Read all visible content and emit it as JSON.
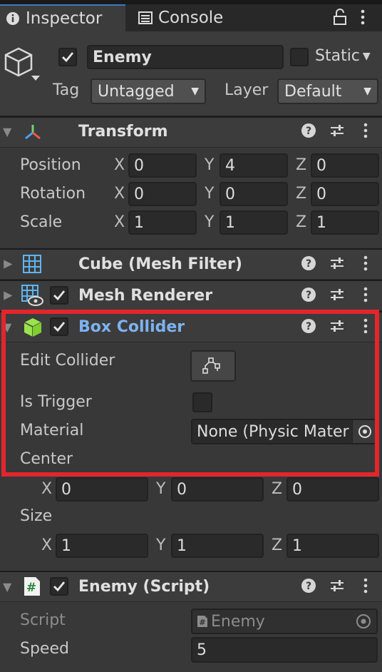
{
  "tabs": {
    "inspector": "Inspector",
    "console": "Console"
  },
  "object": {
    "name": "Enemy",
    "static_label": "Static",
    "tag_label": "Tag",
    "tag_value": "Untagged",
    "layer_label": "Layer",
    "layer_value": "Default"
  },
  "transform": {
    "title": "Transform",
    "rows": [
      {
        "label": "Position",
        "x": "0",
        "y": "4",
        "z": "0"
      },
      {
        "label": "Rotation",
        "x": "0",
        "y": "0",
        "z": "0"
      },
      {
        "label": "Scale",
        "x": "1",
        "y": "1",
        "z": "1"
      }
    ]
  },
  "axes": {
    "x": "X",
    "y": "Y",
    "z": "Z"
  },
  "mesh_filter": {
    "title": "Cube (Mesh Filter)"
  },
  "mesh_renderer": {
    "title": "Mesh Renderer"
  },
  "box_collider": {
    "title": "Box Collider",
    "edit_collider": "Edit Collider",
    "is_trigger": "Is Trigger",
    "material_label": "Material",
    "material_value": "None (Physic Mater",
    "center_label": "Center",
    "center": {
      "x": "0",
      "y": "0",
      "z": "0"
    },
    "size_label": "Size",
    "size": {
      "x": "1",
      "y": "1",
      "z": "1"
    }
  },
  "enemy_script": {
    "title": "Enemy (Script)",
    "script_label": "Script",
    "script_value": "Enemy",
    "speed_label": "Speed",
    "speed_value": "5"
  },
  "colors": {
    "accent": "#3a79bb",
    "highlight": "#e3262c",
    "active_title": "#7db2f0"
  }
}
